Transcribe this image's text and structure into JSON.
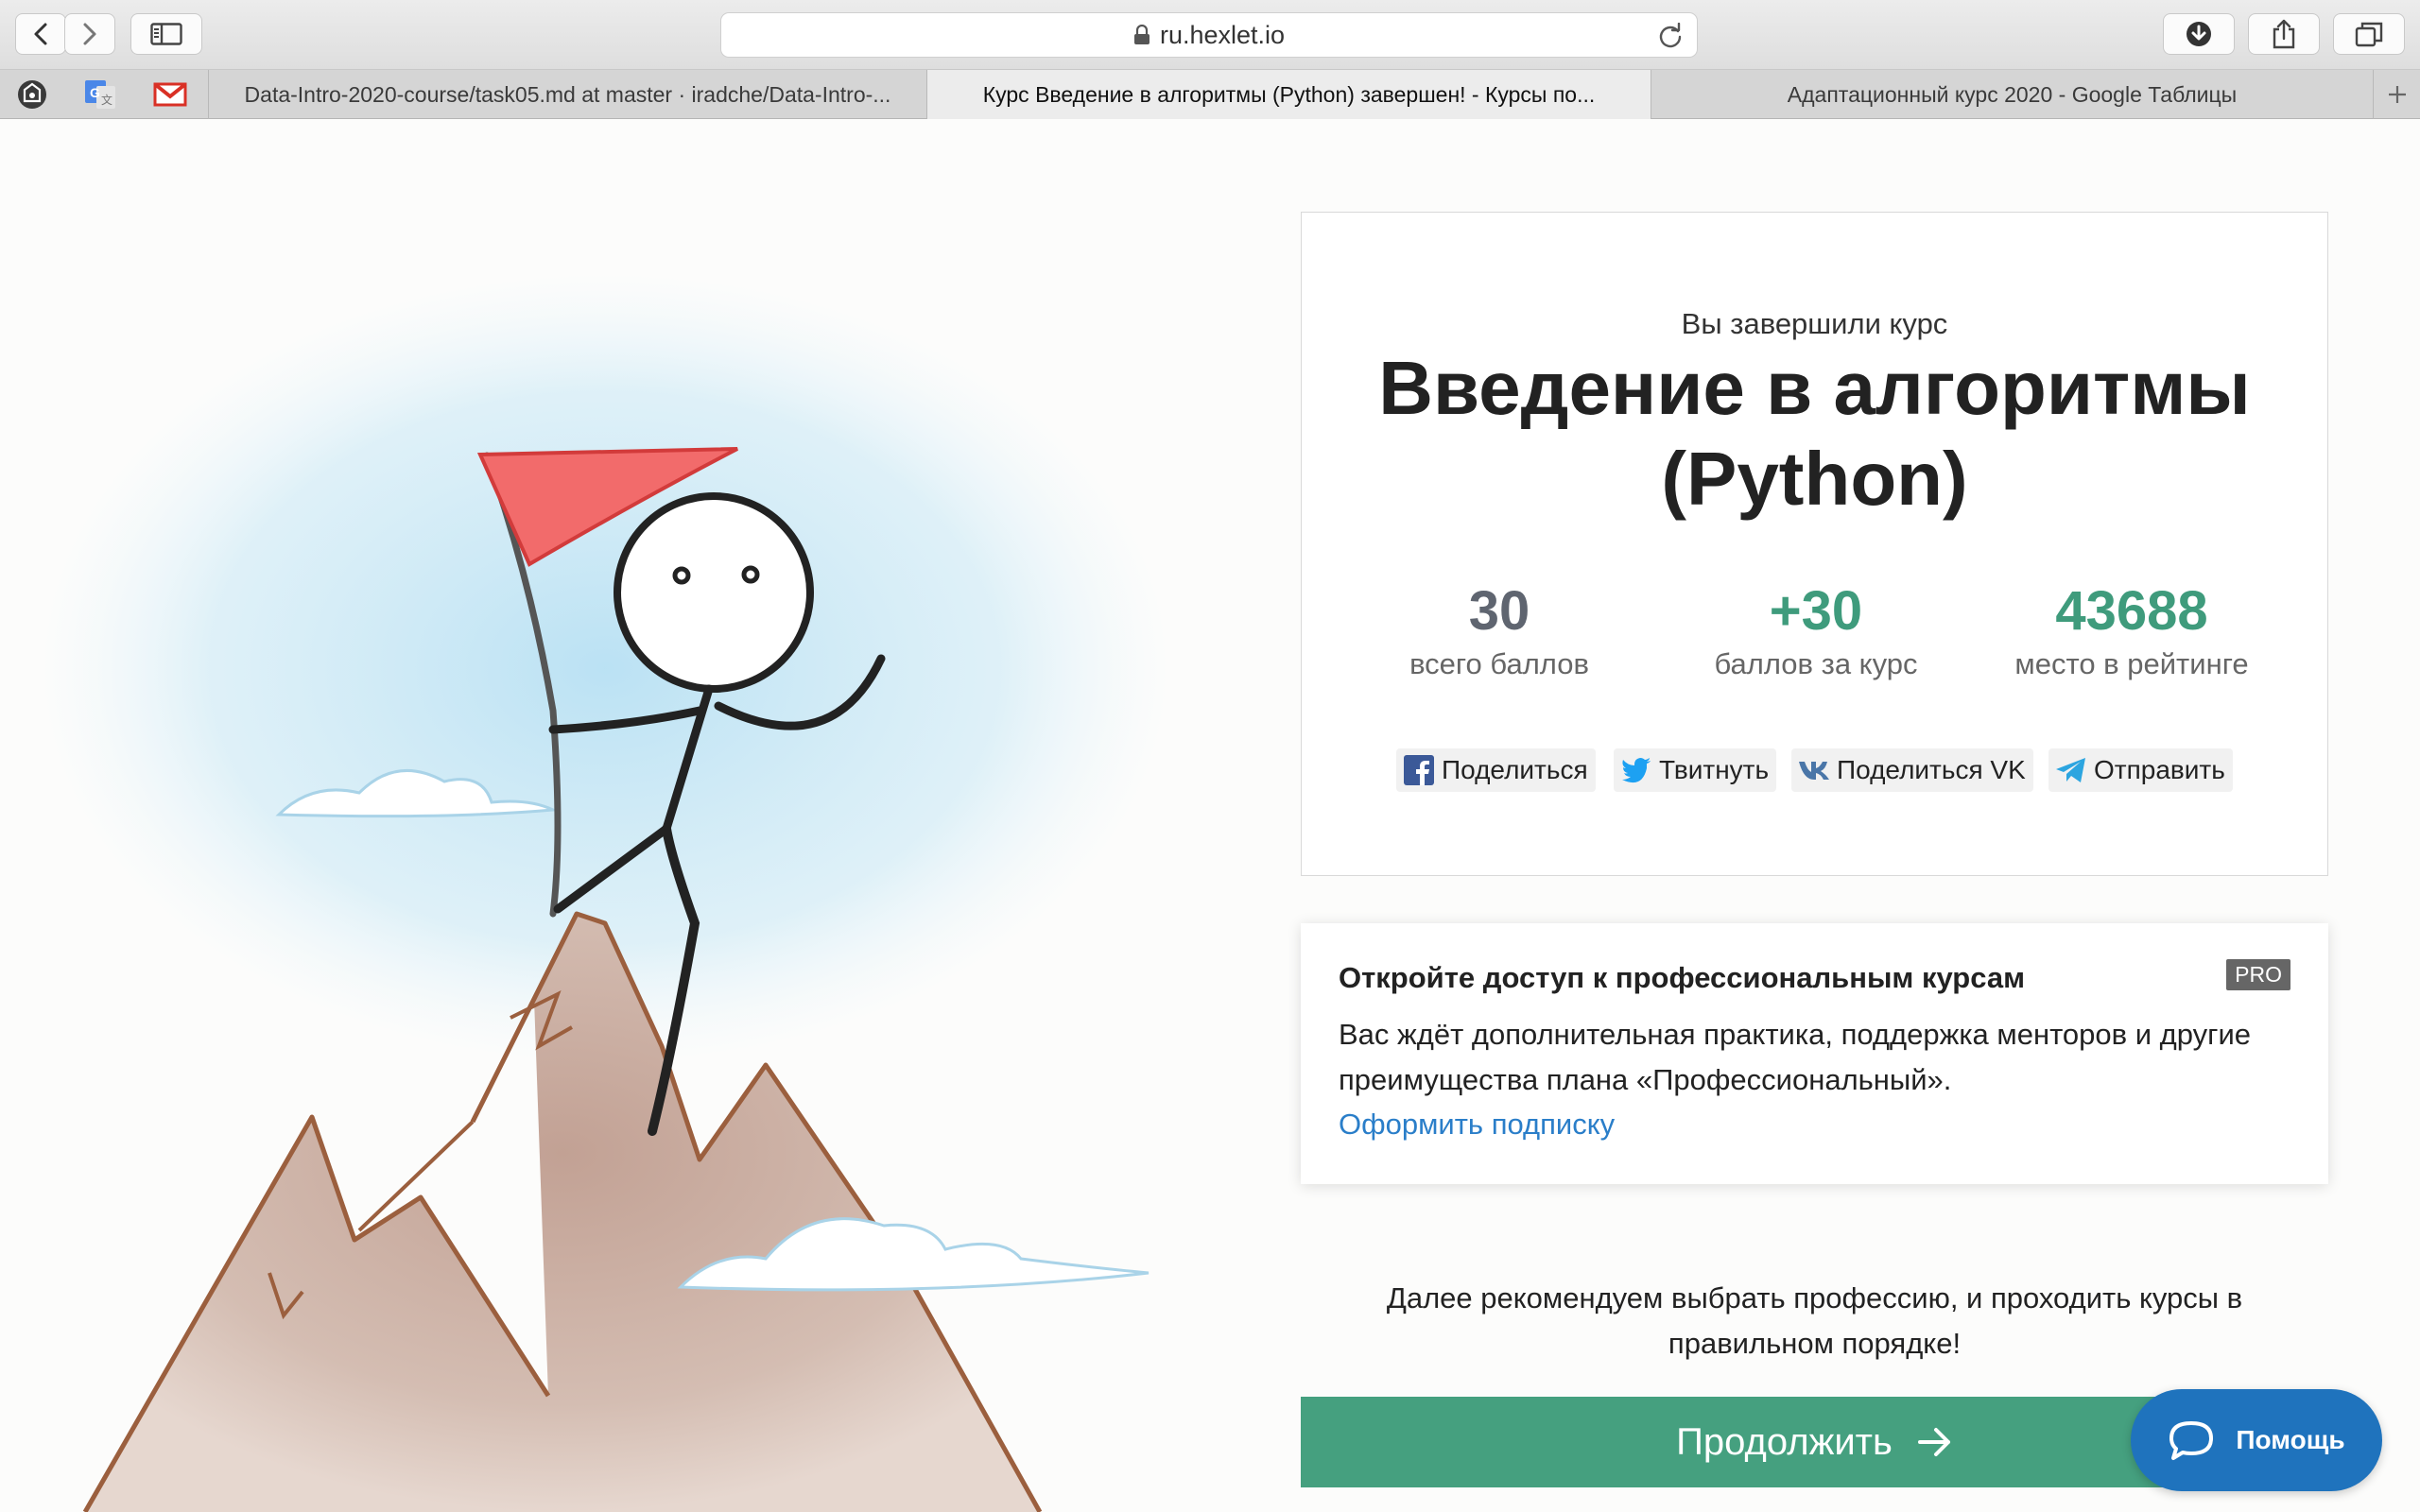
{
  "browser": {
    "url": "ru.hexlet.io",
    "tabs": [
      {
        "title": "Data-Intro-2020-course/task05.md at master · iradche/Data-Intro-...",
        "active": false
      },
      {
        "title": "Курс Введение в алгоритмы (Python) завершен! - Курсы по...",
        "active": true
      },
      {
        "title": "Адаптационный курс 2020 - Google Таблицы",
        "active": false
      }
    ]
  },
  "completion": {
    "kicker": "Вы завершили курс",
    "course_title": "Введение в алгоритмы (Python)",
    "stats": [
      {
        "value": "30",
        "label": "всего баллов"
      },
      {
        "value": "+30",
        "label": "баллов за курс"
      },
      {
        "value": "43688",
        "label": "место в рейтинге"
      }
    ],
    "share": {
      "facebook": "Поделиться",
      "twitter": "Твитнуть",
      "vk": "Поделиться VK",
      "telegram": "Отправить"
    }
  },
  "pro": {
    "heading": "Откройте доступ к профессиональным курсам",
    "badge": "PRO",
    "body": "Вас ждёт дополнительная практика, поддержка менторов и другие преимущества плана «Профессиональный».",
    "link": "Оформить подписку"
  },
  "recommendation": "Далее рекомендуем выбрать профессию, и проходить курсы в правильном порядке!",
  "continue_label": "Продолжить",
  "help_label": "Помощь",
  "colors": {
    "green": "#45a07f",
    "stat_green": "#3f9b7c",
    "link_blue": "#2a7ec9",
    "help_blue": "#1f73bd",
    "flag_red": "#e84a4a"
  }
}
